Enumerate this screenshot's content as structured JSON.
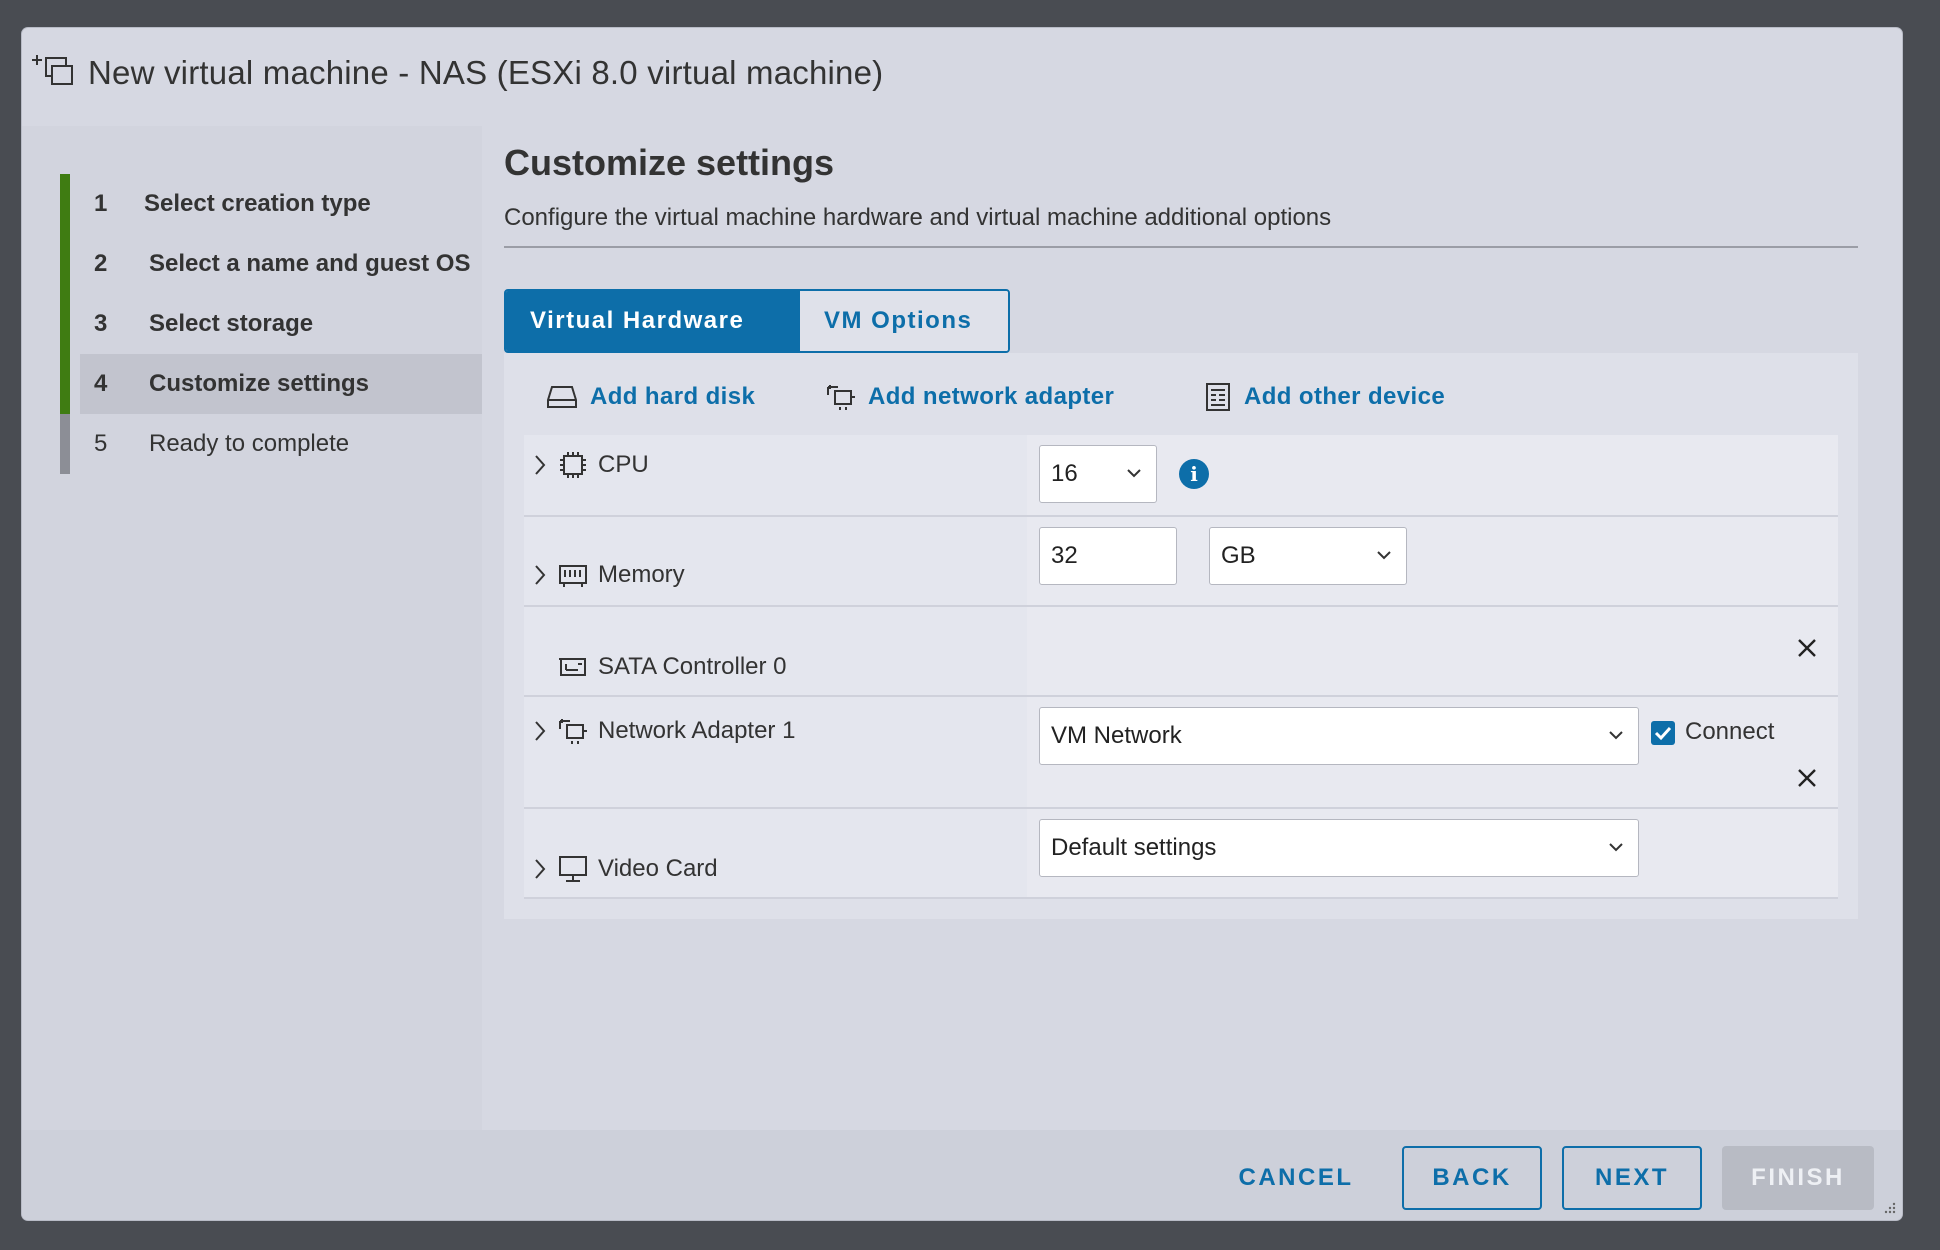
{
  "window": {
    "title": "New virtual machine - NAS (ESXi 8.0 virtual machine)"
  },
  "steps": [
    {
      "num": "1",
      "label": "Select creation type",
      "state": "done"
    },
    {
      "num": "2",
      "label": "Select a name and guest OS",
      "state": "done"
    },
    {
      "num": "3",
      "label": "Select storage",
      "state": "done"
    },
    {
      "num": "4",
      "label": "Customize settings",
      "state": "active"
    },
    {
      "num": "5",
      "label": "Ready to complete",
      "state": "pending"
    }
  ],
  "main": {
    "title": "Customize settings",
    "subtitle": "Configure the virtual machine hardware and virtual machine additional options",
    "tabs": [
      {
        "label": "Virtual Hardware",
        "active": true
      },
      {
        "label": "VM Options",
        "active": false
      }
    ],
    "actions": {
      "add_hard_disk": "Add hard disk",
      "add_network_adapter": "Add network adapter",
      "add_other_device": "Add other device"
    },
    "devices": {
      "cpu": {
        "label": "CPU",
        "value": "16"
      },
      "memory": {
        "label": "Memory",
        "value": "32",
        "unit": "GB"
      },
      "sata": {
        "label": "SATA Controller 0"
      },
      "network": {
        "label": "Network Adapter 1",
        "value": "VM Network",
        "connect_label": "Connect",
        "connected": true
      },
      "video": {
        "label": "Video Card",
        "value": "Default settings"
      }
    }
  },
  "footer": {
    "cancel": "CANCEL",
    "back": "BACK",
    "next": "NEXT",
    "finish": "FINISH"
  },
  "colors": {
    "accent": "#0d6ea9",
    "step_done": "#3f7c12",
    "backdrop": "#494c52"
  }
}
